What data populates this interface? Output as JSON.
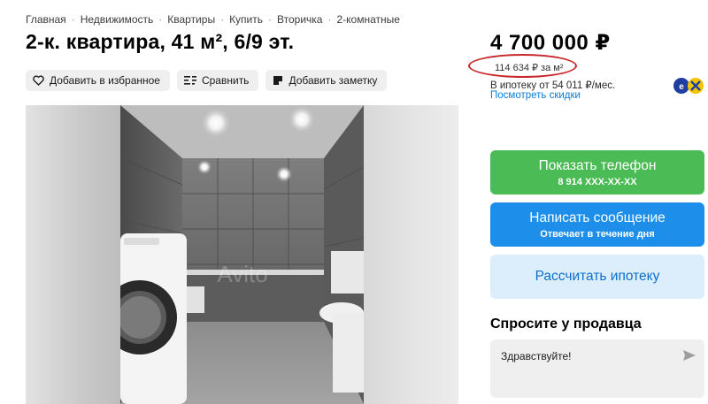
{
  "breadcrumb": [
    "Главная",
    "Недвижимость",
    "Квартиры",
    "Купить",
    "Вторичка",
    "2-комнатные"
  ],
  "title": "2-к. квартира, 41 м², 6/9 эт.",
  "actions": {
    "favorite": "Добавить в избранное",
    "compare": "Сравнить",
    "note": "Добавить заметку"
  },
  "price": {
    "total": "4 700 000 ₽",
    "per_m2": "114 634 ₽ за м²",
    "mortgage": "В ипотеку от 54 011 ₽/мес.",
    "discounts": "Посмотреть скидки"
  },
  "contact": {
    "phone_label": "Показать телефон",
    "phone_number": "8 914 XXX-XX-XX",
    "message_label": "Написать сообщение",
    "message_sub": "Отвечает в течение дня",
    "mortgage_label": "Рассчитать ипотеку"
  },
  "ask": {
    "title": "Спросите у продавца",
    "input_value": "Здравствуйте!"
  },
  "colors": {
    "green": "#4bbb55",
    "blue": "#1d8fea",
    "light_blue": "#dceefb",
    "link": "#0a7bd6",
    "annotation_circle": "#c7262b"
  },
  "icons": [
    "heart-icon",
    "compare-icon",
    "note-icon",
    "send-icon",
    "bank-logo-icon"
  ]
}
